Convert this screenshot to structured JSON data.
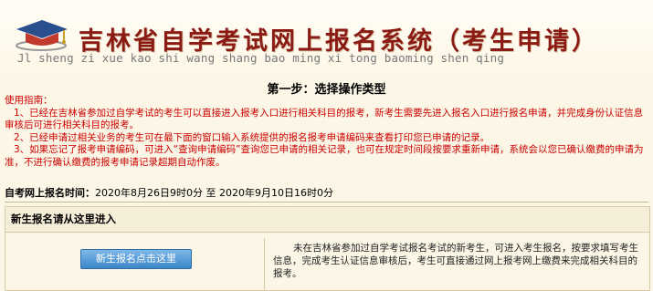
{
  "header": {
    "title": "吉林省自学考试网上报名系统（考生申请）",
    "pinyin": "Jl sheng zi xue kao shi wang shang bao ming xi tong baoming shen qing"
  },
  "step_title": "第一步：选择操作类型",
  "guide": {
    "heading": "使用指南：",
    "item1": "1、已经在吉林省参加过自学考试的考生可以直接进入报考入口进行相关科目的报考，新考生需要先进入报名入口进行报名申请，并完成身份认证信息审核后可进行相关科目的报考。",
    "item2": "2、已经申请过相关业务的考生可在最下面的窗口输入系统提供的报名报考申请编码来查看打印您已申请的记录。",
    "item3": "3、如果忘记了报考申请编码，可进入“查询申请编码”查询您已申请的相关记录，也可在规定时间段按要求重新申请，系统会以您已确认缴费的申请为准，不进行确认缴费的报考申请记录超期自动作废。"
  },
  "registration_time": {
    "label": "自考网上报名时间：",
    "value": "2020年8月26日9时0分 至 2020年9月10日16时0分"
  },
  "new_student": {
    "section_title": "新生报名请从这里进入",
    "button_label": "新生报名点击这里",
    "description": "未在吉林省参加过自学考试报名考试的新考生，可进入考生报名，按要求填写考生信息，完成考生认证信息审核后，考生可直接通过网上报考网上缴费来完成相关科目的报考。"
  },
  "colors": {
    "background": "#fbf6e6",
    "title": "#8b1a14",
    "guide_text": "#cc0000",
    "button": "#3b86c9"
  },
  "icons": {
    "logo": "graduation-cap-logo"
  }
}
